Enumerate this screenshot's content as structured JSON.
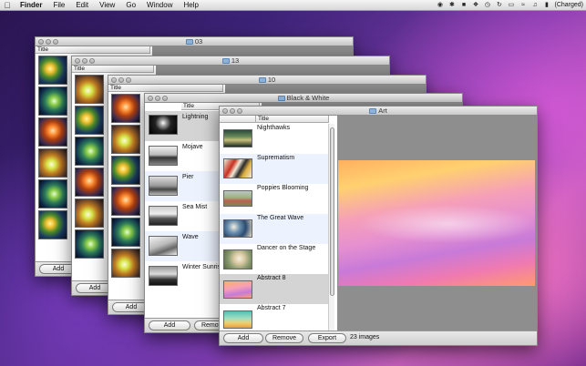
{
  "menubar": {
    "app_name": "Finder",
    "items": [
      "File",
      "Edit",
      "View",
      "Go",
      "Window",
      "Help"
    ],
    "status_text": "(Charged)"
  },
  "windows": {
    "w03": {
      "title": "03",
      "col_title": "Title",
      "add_label": "Add"
    },
    "w13": {
      "title": "13",
      "col_title": "Title",
      "add_label": "Add"
    },
    "w10": {
      "title": "10",
      "col_title": "Title",
      "add_label": "Add"
    },
    "bw": {
      "title": "Black & White",
      "col_title": "Title",
      "add_label": "Add",
      "remove_label": "Remove",
      "rows": [
        "Lightning",
        "Mojave",
        "Pier",
        "Sea Mist",
        "Wave",
        "Winter Sunrise"
      ]
    },
    "art": {
      "title": "Art",
      "col_title": "Title",
      "add_label": "Add",
      "remove_label": "Remove",
      "export_label": "Export",
      "count_text": "23 images",
      "rows": [
        "Nighthawks",
        "Suprematism",
        "Poppies Blooming",
        "The Great Wave",
        "Dancer on the Stage",
        "Abstract 8",
        "Abstract 7"
      ]
    }
  }
}
